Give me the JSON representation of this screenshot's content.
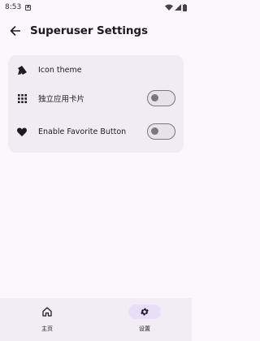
{
  "status_bar": {
    "time": "8:53",
    "notification_icon": "a-badge-icon",
    "wifi_icon": "wifi-icon",
    "signal_icon": "signal-icon",
    "battery_icon": "battery-icon"
  },
  "app_bar": {
    "title": "Superuser Settings",
    "back_icon": "arrow-back-icon"
  },
  "settings": {
    "items": [
      {
        "label": "Icon theme",
        "icon": "icon-theme-icon",
        "has_toggle": false
      },
      {
        "label": "独立应用卡片",
        "icon": "grid-icon",
        "has_toggle": true,
        "toggle_on": false
      },
      {
        "label": "Enable Favorite Button",
        "icon": "heart-icon",
        "has_toggle": true,
        "toggle_on": false
      }
    ]
  },
  "bottom_nav": {
    "items": [
      {
        "label": "主页",
        "icon": "home-icon",
        "active": false
      },
      {
        "label": "设置",
        "icon": "gear-icon",
        "active": true
      }
    ]
  },
  "colors": {
    "background": "#fcf7fc",
    "card": "#f1ecf4",
    "nav_active_pill": "#e8def8",
    "toggle_outline": "#7b757f"
  }
}
